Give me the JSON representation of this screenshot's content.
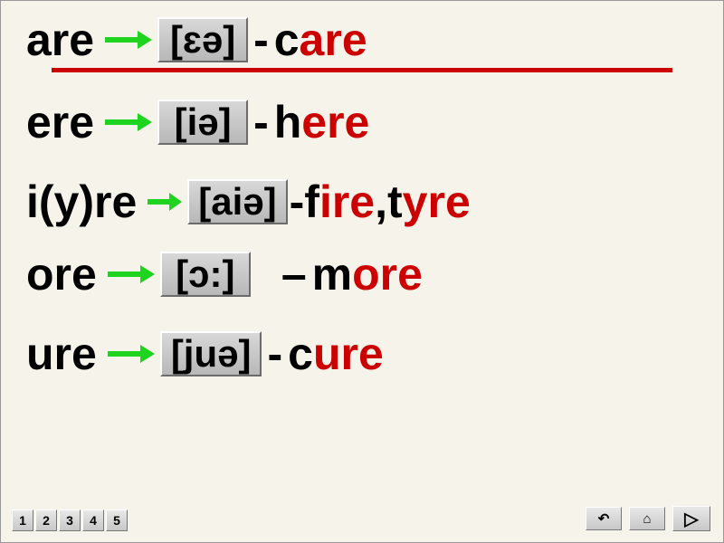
{
  "rows": [
    {
      "pattern": "are",
      "ipa": "[ɛə]",
      "word_stem": "c",
      "word_end": "are"
    },
    {
      "pattern": "ere",
      "ipa": "[iə]",
      "word_stem": "h",
      "word_end": "ere"
    },
    {
      "pattern": "i(y)re",
      "ipa": "[aiə]",
      "word_stem": "f",
      "word_end": "ire",
      "word2_stem": "t",
      "word2_end": "yre"
    },
    {
      "pattern": "ore",
      "ipa": "[ɔ:]",
      "word_stem": "m",
      "word_end": "ore"
    },
    {
      "pattern": "ure",
      "ipa": "[juə]",
      "word_stem": "c",
      "word_end": "ure"
    }
  ],
  "pager": [
    "1",
    "2",
    "3",
    "4",
    "5"
  ],
  "nav": {
    "undo": "↶",
    "home": "⌂",
    "next": "▷"
  }
}
